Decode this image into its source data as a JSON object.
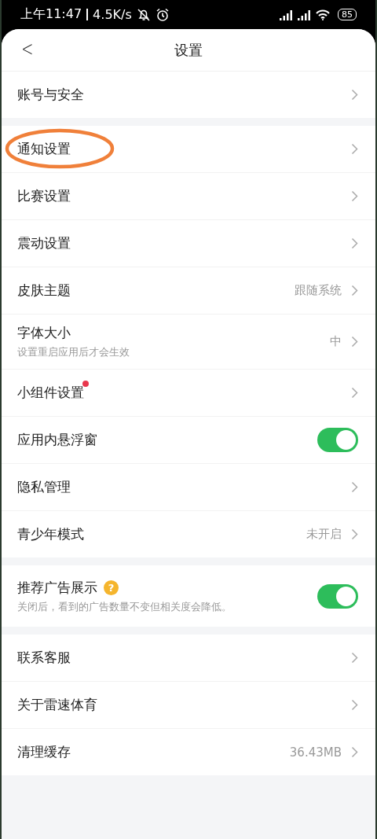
{
  "status_bar": {
    "time": "上午11:47",
    "speed": "4.5K/s",
    "battery": "85"
  },
  "header": {
    "back": "<",
    "title": "设置"
  },
  "groups": [
    {
      "rows": [
        {
          "kind": "link",
          "label": "账号与安全"
        }
      ]
    },
    {
      "rows": [
        {
          "kind": "link",
          "label": "通知设置",
          "highlighted": true
        },
        {
          "kind": "link",
          "label": "比赛设置"
        },
        {
          "kind": "link",
          "label": "震动设置"
        },
        {
          "kind": "link",
          "label": "皮肤主题",
          "value": "跟随系统"
        },
        {
          "kind": "link",
          "label": "字体大小",
          "sublabel": "设置重启应用后才会生效",
          "value": "中"
        },
        {
          "kind": "link",
          "label": "小组件设置",
          "dot": true
        },
        {
          "kind": "toggle",
          "label": "应用内悬浮窗",
          "on": true
        },
        {
          "kind": "link",
          "label": "隐私管理"
        },
        {
          "kind": "link",
          "label": "青少年模式",
          "value": "未开启"
        }
      ]
    },
    {
      "rows": [
        {
          "kind": "toggle",
          "label": "推荐广告展示",
          "help": "?",
          "sublabel": "关闭后，看到的广告数量不变但相关度会降低。",
          "on": true
        }
      ]
    },
    {
      "rows": [
        {
          "kind": "link",
          "label": "联系客服"
        },
        {
          "kind": "link",
          "label": "关于雷速体育"
        },
        {
          "kind": "link",
          "label": "清理缓存",
          "value": "36.43MB"
        }
      ]
    }
  ]
}
